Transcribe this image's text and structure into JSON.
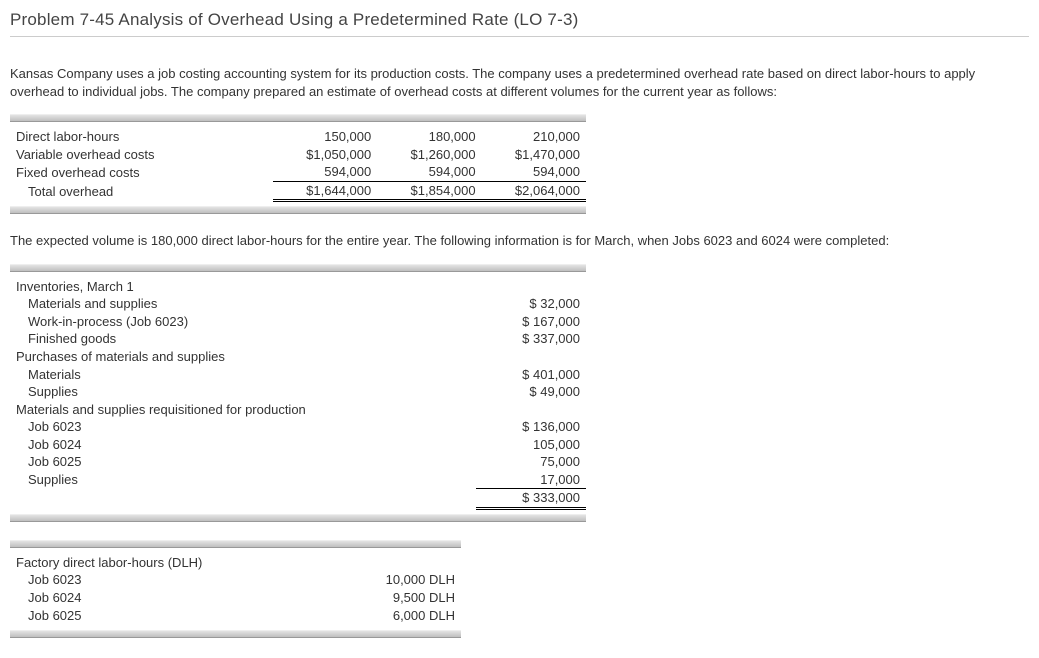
{
  "title": "Problem 7-45 Analysis of Overhead Using a Predetermined Rate (LO 7-3)",
  "intro": "Kansas Company uses a job costing accounting system for its production costs. The company uses a predetermined overhead rate based on direct labor-hours to apply overhead to individual jobs. The company prepared an estimate of overhead costs at different volumes for the current year as follows:",
  "mid_text": "The expected volume is 180,000 direct labor-hours for the entire year. The following information is for March, when Jobs 6023 and 6024 were completed:",
  "table1": {
    "rows": {
      "r1": {
        "label": "Direct labor-hours",
        "c1": "150,000",
        "c2": "180,000",
        "c3": "210,000"
      },
      "r2": {
        "label": "Variable overhead costs",
        "c1": "$1,050,000",
        "c2": "$1,260,000",
        "c3": "$1,470,000"
      },
      "r3": {
        "label": "Fixed overhead costs",
        "c1": "594,000",
        "c2": "594,000",
        "c3": "594,000"
      },
      "r4": {
        "label": "Total overhead",
        "c1": "$1,644,000",
        "c2": "$1,854,000",
        "c3": "$2,064,000"
      }
    }
  },
  "table2": {
    "h1": "Inventories, March 1",
    "r1": {
      "label": "Materials and supplies",
      "val": "$  32,000"
    },
    "r2": {
      "label": "Work-in-process (Job 6023)",
      "val": "$ 167,000"
    },
    "r3": {
      "label": "Finished goods",
      "val": "$ 337,000"
    },
    "h2": "Purchases of materials and supplies",
    "r4": {
      "label": "Materials",
      "val": "$ 401,000"
    },
    "r5": {
      "label": "Supplies",
      "val": "$  49,000"
    },
    "h3": "Materials and supplies requisitioned for production",
    "r6": {
      "label": "Job 6023",
      "val": "$ 136,000"
    },
    "r7": {
      "label": "Job 6024",
      "val": "105,000"
    },
    "r8": {
      "label": "Job 6025",
      "val": "75,000"
    },
    "r9": {
      "label": "Supplies",
      "val": "17,000"
    },
    "tot": {
      "val": "$ 333,000"
    }
  },
  "table3": {
    "h1": "Factory direct labor-hours (DLH)",
    "r1": {
      "label": "Job 6023",
      "val": "10,000 DLH"
    },
    "r2": {
      "label": "Job 6024",
      "val": "9,500 DLH"
    },
    "r3": {
      "label": "Job 6025",
      "val": "6,000 DLH"
    }
  }
}
